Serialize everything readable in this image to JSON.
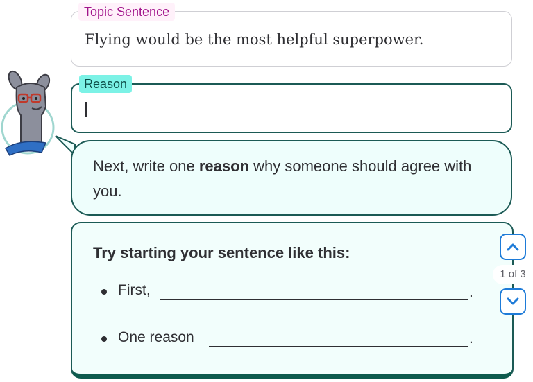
{
  "topic": {
    "label": "Topic Sentence",
    "text": "Flying would be the most helpful superpower."
  },
  "reason": {
    "label": "Reason",
    "value": ""
  },
  "bubble": {
    "prefix": "Next, write one ",
    "bold": "reason",
    "suffix": " why someone should agree with you."
  },
  "hint": {
    "title": "Try starting your sentence like this:",
    "items": [
      {
        "text": "First,",
        "end": "."
      },
      {
        "text": "One reason",
        "end": "."
      }
    ]
  },
  "pager": {
    "label": "1 of 3",
    "up_icon": "chevron-up-icon",
    "down_icon": "chevron-down-icon"
  },
  "colors": {
    "topic_accent": "#a1158b",
    "reason_accent": "#7cf2e6",
    "border_dark": "#1b5a55",
    "pager_blue": "#1e7bd8"
  }
}
